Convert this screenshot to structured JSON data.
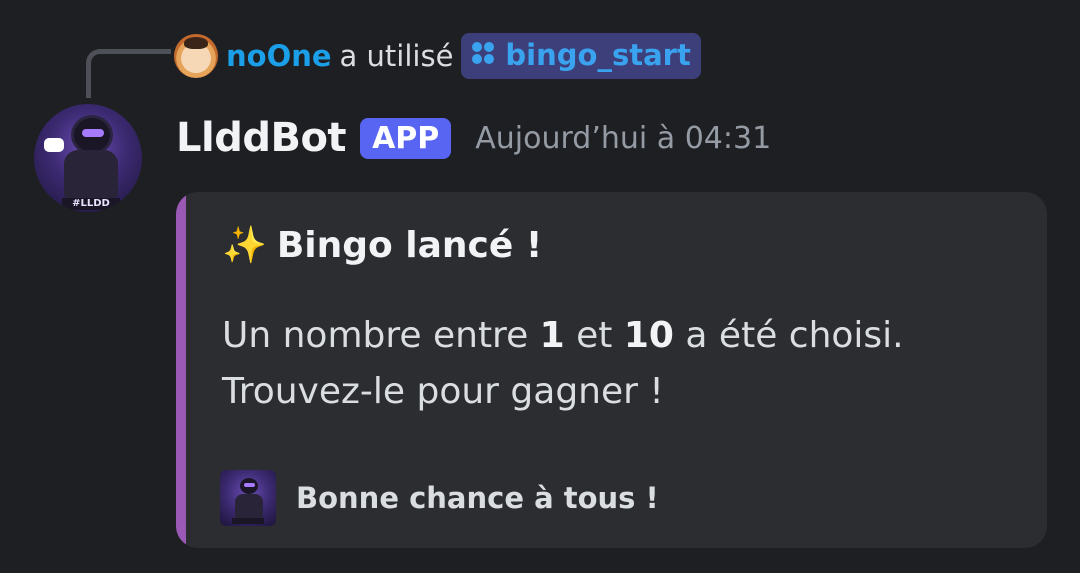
{
  "reply": {
    "username": "noOne",
    "action": "a utilisé",
    "command_icon": "slash-command-icon",
    "command_name": "bingo_start"
  },
  "message": {
    "author": "LlddBot",
    "badge": "APP",
    "timestamp": "Aujourd’hui à 04:31",
    "avatar_label": "#LLDD"
  },
  "embed": {
    "accent_color": "#9b59b6",
    "title_emoji": "✨",
    "title": "Bingo lancé !",
    "desc_prefix": "Un nombre entre ",
    "desc_num1": "1",
    "desc_mid": " et ",
    "desc_num2": "10",
    "desc_suffix": " a été choisi.",
    "desc_line2": "Trouvez-le pour gagner !",
    "footer_text": "Bonne chance à tous !"
  },
  "colors": {
    "background": "#1e1f22",
    "username": "#1a9fe8",
    "command": "#3aa3f0",
    "app_badge": "#5865f2"
  }
}
